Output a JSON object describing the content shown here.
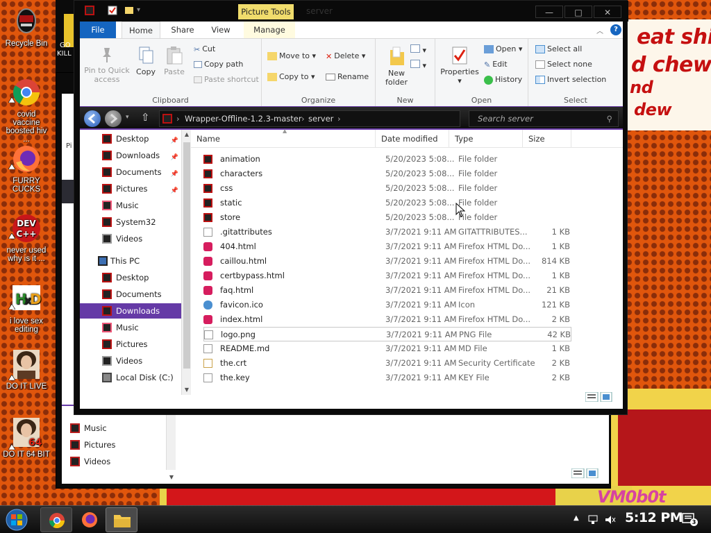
{
  "desktop": {
    "banner_lines": [
      "eat shit",
      "d chew",
      "nd",
      "dew"
    ],
    "watermark": "VM0b0t",
    "back_window_partial_text": [
      "GO",
      "KILL"
    ],
    "icons": [
      {
        "label": "Recycle Bin",
        "icon": "recycle-bin-icon"
      },
      {
        "label": "covid vaccine boosted hiv ...",
        "icon": "chrome-icon"
      },
      {
        "label": "FURRY CUCKS",
        "icon": "firefox-icon"
      },
      {
        "label": "never used why is it ...",
        "icon": "devcpp-icon"
      },
      {
        "label": "i love sex editing",
        "icon": "hxd-icon"
      },
      {
        "label": "DO IT LIVE",
        "icon": "portrait-icon"
      },
      {
        "label": "DO IT 64 BIT",
        "icon": "portrait-64-icon"
      }
    ]
  },
  "back_window": {
    "nav_items": [
      "Music",
      "Pictures",
      "Videos"
    ],
    "side_letter": "Pi"
  },
  "window": {
    "title": "server",
    "context_tab": "Picture Tools",
    "tabs": [
      "File",
      "Home",
      "Share",
      "View",
      "Manage"
    ],
    "active_tab": "Home",
    "controls": {
      "minimize": "—",
      "maximize": "□",
      "close": "✕"
    },
    "help": "?"
  },
  "ribbon": {
    "clipboard": {
      "label": "Clipboard",
      "pin": "Pin to Quick access",
      "copy": "Copy",
      "paste": "Paste",
      "cut": "Cut",
      "copy_path": "Copy path",
      "paste_shortcut": "Paste shortcut"
    },
    "organize": {
      "label": "Organize",
      "move_to": "Move to",
      "copy_to": "Copy to",
      "delete": "Delete",
      "rename": "Rename"
    },
    "new": {
      "label": "New",
      "new_folder": "New folder"
    },
    "open": {
      "label": "Open",
      "properties": "Properties",
      "open": "Open",
      "edit": "Edit",
      "history": "History"
    },
    "select": {
      "label": "Select",
      "select_all": "Select all",
      "select_none": "Select none",
      "invert": "Invert selection"
    }
  },
  "address": {
    "path": [
      "Wrapper-Offline-1.2.3-master",
      "server"
    ],
    "search_placeholder": "Search server"
  },
  "nav": {
    "quick_access": [
      {
        "label": "Desktop",
        "pinned": true
      },
      {
        "label": "Downloads",
        "pinned": true
      },
      {
        "label": "Documents",
        "pinned": true
      },
      {
        "label": "Pictures",
        "pinned": true
      },
      {
        "label": "Music",
        "pinned": false
      },
      {
        "label": "System32",
        "pinned": false
      },
      {
        "label": "Videos",
        "pinned": false
      }
    ],
    "this_pc": "This PC",
    "this_pc_items": [
      "Desktop",
      "Documents",
      "Downloads",
      "Music",
      "Pictures",
      "Videos",
      "Local Disk (C:)"
    ],
    "selected": "Downloads"
  },
  "columns": [
    "Name",
    "Date modified",
    "Type",
    "Size"
  ],
  "files": [
    {
      "name": "animation",
      "date": "5/20/2023 5:08...",
      "type": "File folder",
      "size": "",
      "kind": "folder"
    },
    {
      "name": "characters",
      "date": "5/20/2023 5:08...",
      "type": "File folder",
      "size": "",
      "kind": "folder"
    },
    {
      "name": "css",
      "date": "5/20/2023 5:08...",
      "type": "File folder",
      "size": "",
      "kind": "folder"
    },
    {
      "name": "static",
      "date": "5/20/2023 5:08...",
      "type": "File folder",
      "size": "",
      "kind": "folder"
    },
    {
      "name": "store",
      "date": "5/20/2023 5:08...",
      "type": "File folder",
      "size": "",
      "kind": "folder"
    },
    {
      "name": ".gitattributes",
      "date": "3/7/2021 9:11 AM",
      "type": "GITATTRIBUTES...",
      "size": "1 KB",
      "kind": "doc"
    },
    {
      "name": "404.html",
      "date": "3/7/2021 9:11 AM",
      "type": "Firefox HTML Do...",
      "size": "1 KB",
      "kind": "html"
    },
    {
      "name": "caillou.html",
      "date": "3/7/2021 9:11 AM",
      "type": "Firefox HTML Do...",
      "size": "814 KB",
      "kind": "html"
    },
    {
      "name": "certbypass.html",
      "date": "3/7/2021 9:11 AM",
      "type": "Firefox HTML Do...",
      "size": "1 KB",
      "kind": "html"
    },
    {
      "name": "faq.html",
      "date": "3/7/2021 9:11 AM",
      "type": "Firefox HTML Do...",
      "size": "21 KB",
      "kind": "html"
    },
    {
      "name": "favicon.ico",
      "date": "3/7/2021 9:11 AM",
      "type": "Icon",
      "size": "121 KB",
      "kind": "ico"
    },
    {
      "name": "index.html",
      "date": "3/7/2021 9:11 AM",
      "type": "Firefox HTML Do...",
      "size": "2 KB",
      "kind": "html"
    },
    {
      "name": "logo.png",
      "date": "3/7/2021 9:11 AM",
      "type": "PNG File",
      "size": "42 KB",
      "kind": "png"
    },
    {
      "name": "README.md",
      "date": "3/7/2021 9:11 AM",
      "type": "MD File",
      "size": "1 KB",
      "kind": "doc"
    },
    {
      "name": "the.crt",
      "date": "3/7/2021 9:11 AM",
      "type": "Security Certificate",
      "size": "2 KB",
      "kind": "crt"
    },
    {
      "name": "the.key",
      "date": "3/7/2021 9:11 AM",
      "type": "KEY File",
      "size": "2 KB",
      "kind": "doc"
    }
  ],
  "taskbar": {
    "clock": "5:12 PM",
    "notification_count": "3",
    "pinned": [
      "chrome-icon",
      "firefox-icon",
      "file-explorer-icon"
    ]
  },
  "colors": {
    "accent_purple": "#653aa6",
    "file_tab_blue": "#1565c0",
    "context_tab_yellow": "#f0dc6c"
  }
}
